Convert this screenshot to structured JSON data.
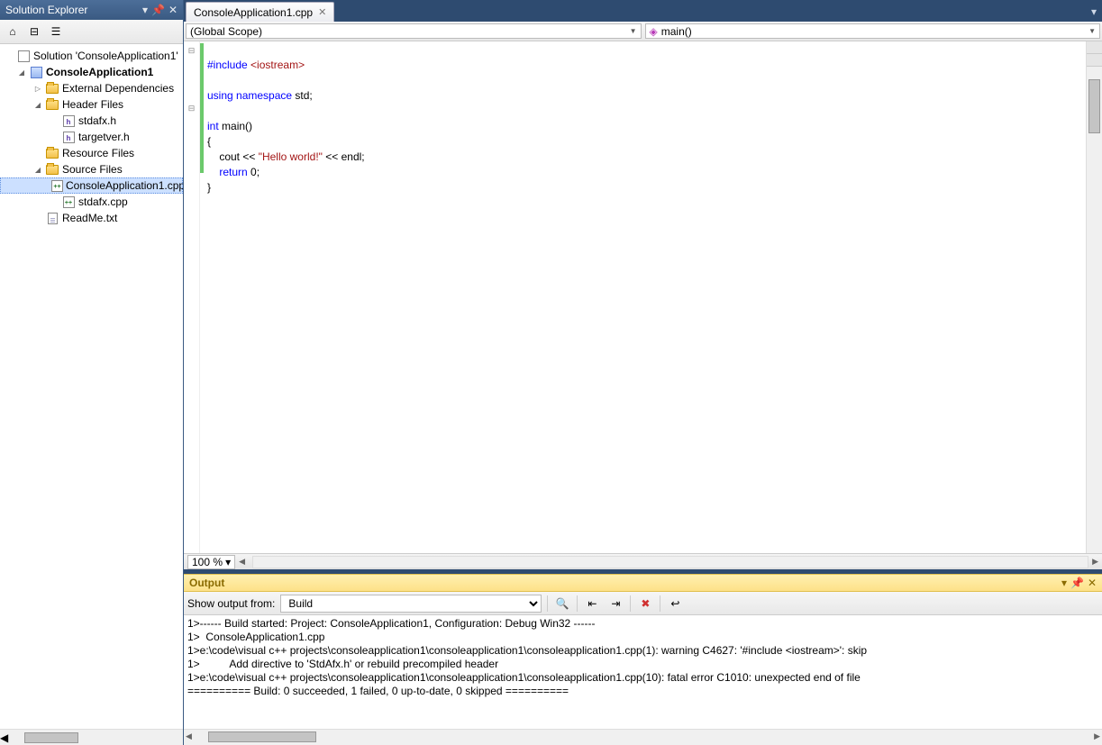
{
  "solutionExplorer": {
    "title": "Solution Explorer",
    "tree": {
      "solution": "Solution 'ConsoleApplication1'",
      "project": "ConsoleApplication1",
      "externalDeps": "External Dependencies",
      "headerFiles": "Header Files",
      "stdafx_h": "stdafx.h",
      "targetver_h": "targetver.h",
      "resourceFiles": "Resource Files",
      "sourceFiles": "Source Files",
      "consoleApp_cpp": "ConsoleApplication1.cpp",
      "stdafx_cpp": "stdafx.cpp",
      "readme": "ReadMe.txt"
    }
  },
  "editor": {
    "tabLabel": "ConsoleApplication1.cpp",
    "scopeLeft": "(Global Scope)",
    "scopeRight": "main()",
    "zoom": "100 %",
    "code": {
      "l1a": "#include ",
      "l1b": "<iostream>",
      "l2": "",
      "l3a": "using ",
      "l3b": "namespace",
      "l3c": " std;",
      "l4": "",
      "l5a": "int",
      "l5b": " main()",
      "l6": "{",
      "l7a": "    cout << ",
      "l7b": "\"Hello world!\"",
      "l7c": " << endl;",
      "l8a": "    ",
      "l8b": "return",
      "l8c": " 0;",
      "l9": "}"
    }
  },
  "output": {
    "title": "Output",
    "showFromLabel": "Show output from:",
    "sourceSelected": "Build",
    "lines": [
      "1>------ Build started: Project: ConsoleApplication1, Configuration: Debug Win32 ------",
      "1>  ConsoleApplication1.cpp",
      "1>e:\\code\\visual c++ projects\\consoleapplication1\\consoleapplication1\\consoleapplication1.cpp(1): warning C4627: '#include <iostream>': skip",
      "1>          Add directive to 'StdAfx.h' or rebuild precompiled header",
      "1>e:\\code\\visual c++ projects\\consoleapplication1\\consoleapplication1\\consoleapplication1.cpp(10): fatal error C1010: unexpected end of file",
      "========== Build: 0 succeeded, 1 failed, 0 up-to-date, 0 skipped =========="
    ]
  }
}
